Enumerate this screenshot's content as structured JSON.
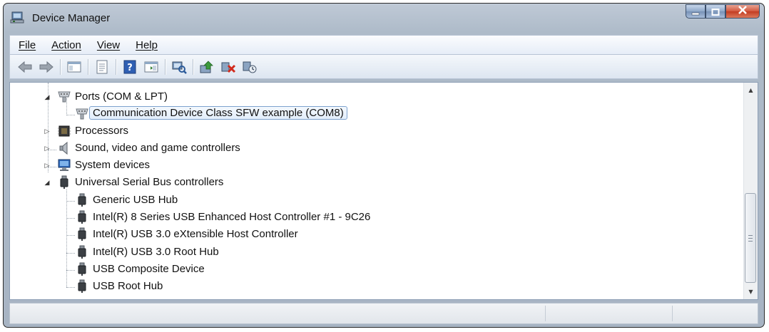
{
  "window": {
    "title": "Device Manager",
    "icons": {
      "app": "device-manager-icon",
      "minimize": "minimize-icon",
      "maximize": "maximize-icon",
      "close": "close-icon"
    }
  },
  "menu": {
    "file": "File",
    "action": "Action",
    "view": "View",
    "help": "Help"
  },
  "toolbar": {
    "buttons": [
      "back-arrow-icon",
      "forward-arrow-icon",
      "show-hide-console-tree-icon",
      "properties-icon",
      "help-icon",
      "show-hide-action-pane-icon",
      "scan-hardware-changes-icon",
      "update-driver-icon",
      "disable-device-icon",
      "uninstall-device-icon"
    ]
  },
  "tree": {
    "items": [
      {
        "label": "Ports (COM & LPT)",
        "expanded": true,
        "icon": "port-icon"
      },
      {
        "label": "Communication Device Class SFW example (COM8)",
        "selected": true,
        "icon": "port-icon"
      },
      {
        "label": "Processors",
        "expanded": false,
        "icon": "processor-icon"
      },
      {
        "label": "Sound, video and game controllers",
        "expanded": false,
        "icon": "speaker-icon"
      },
      {
        "label": "System devices",
        "expanded": false,
        "icon": "computer-icon"
      },
      {
        "label": "Universal Serial Bus controllers",
        "expanded": true,
        "icon": "usb-icon"
      },
      {
        "label": "Generic USB Hub",
        "icon": "usb-icon"
      },
      {
        "label": "Intel(R) 8 Series USB Enhanced Host Controller #1 - 9C26",
        "icon": "usb-icon"
      },
      {
        "label": "Intel(R) USB 3.0 eXtensible Host Controller",
        "icon": "usb-icon"
      },
      {
        "label": "Intel(R) USB 3.0 Root Hub",
        "icon": "usb-icon"
      },
      {
        "label": "USB Composite Device",
        "icon": "usb-icon"
      },
      {
        "label": "USB Root Hub",
        "icon": "usb-icon"
      }
    ]
  },
  "colors": {
    "selection_border": "#7da2ce",
    "close_button": "#c23c22",
    "frame": "#a7b4c3"
  }
}
